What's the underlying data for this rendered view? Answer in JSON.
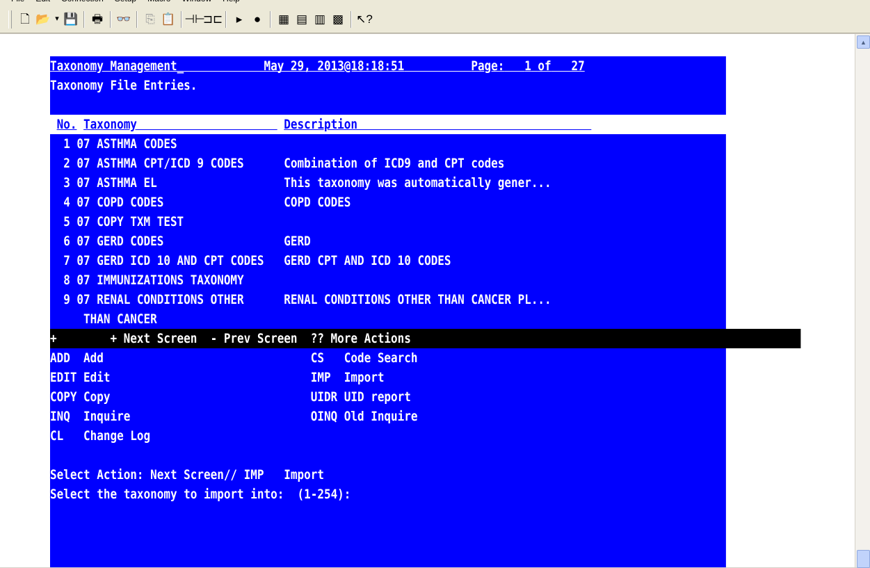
{
  "menu": {
    "items": [
      "File",
      "Edit",
      "Connection",
      "Setup",
      "Macro",
      "Window",
      "Help"
    ]
  },
  "toolbar": {
    "buttons": [
      {
        "icon": "new-document-icon",
        "glyph": "🗋"
      },
      {
        "icon": "open-folder-icon",
        "glyph": "📂"
      },
      {
        "icon": "dropdown-arrow-icon",
        "glyph": "▾"
      },
      {
        "icon": "save-icon",
        "glyph": "💾"
      },
      {
        "icon": "print-icon",
        "glyph": "🖶"
      },
      {
        "icon": "find-icon",
        "glyph": "👓"
      },
      {
        "icon": "copy-icon",
        "glyph": "⎘"
      },
      {
        "icon": "paste-icon",
        "glyph": "📋"
      },
      {
        "icon": "connect-icon",
        "glyph": "⊣⊢"
      },
      {
        "icon": "disconnect-icon",
        "glyph": "⊐⊏"
      },
      {
        "icon": "play-macro-icon",
        "glyph": "▸"
      },
      {
        "icon": "record-macro-icon",
        "glyph": "●"
      },
      {
        "icon": "window-cascade-icon",
        "glyph": "▦"
      },
      {
        "icon": "window-tile-icon",
        "glyph": "▤"
      },
      {
        "icon": "window-arrange-icon",
        "glyph": "▥"
      },
      {
        "icon": "window-all-icon",
        "glyph": "▩"
      },
      {
        "icon": "context-help-icon",
        "glyph": "↖?"
      }
    ]
  },
  "terminal": {
    "header": {
      "title": "Taxonomy Management_",
      "datetime": "May 29, 2013@18:18:51",
      "page_label": "Page:",
      "page_number": "1",
      "page_of": "of",
      "page_total": "27"
    },
    "subtitle": "Taxonomy File Entries.",
    "columns": {
      "no": "No.",
      "taxonomy": "Taxonomy",
      "description": "Description"
    },
    "entries": [
      {
        "no": "1",
        "taxonomy": "07 ASTHMA CODES",
        "description": ""
      },
      {
        "no": "2",
        "taxonomy": "07 ASTHMA CPT/ICD 9 CODES",
        "description": "Combination of ICD9 and CPT codes"
      },
      {
        "no": "3",
        "taxonomy": "07 ASTHMA EL",
        "description": "This taxonomy was automatically gener..."
      },
      {
        "no": "4",
        "taxonomy": "07 COPD CODES",
        "description": "COPD CODES"
      },
      {
        "no": "5",
        "taxonomy": "07 COPY TXM TEST",
        "description": ""
      },
      {
        "no": "6",
        "taxonomy": "07 GERD CODES",
        "description": "GERD"
      },
      {
        "no": "7",
        "taxonomy": "07 GERD ICD 10 AND CPT CODES",
        "description": "GERD CPT AND ICD 10 CODES"
      },
      {
        "no": "8",
        "taxonomy": "07 IMMUNIZATIONS TAXONOMY",
        "description": ""
      },
      {
        "no": "9",
        "taxonomy": "07 RENAL CONDITIONS OTHER",
        "description": "RENAL CONDITIONS OTHER THAN CANCER PL..."
      }
    ],
    "continuation": "THAN CANCER",
    "nav_bar": {
      "marker": "+",
      "next": "+ Next Screen",
      "prev": "- Prev Screen",
      "more": "?? More Actions"
    },
    "actions_left": [
      {
        "code": "ADD",
        "label": "Add"
      },
      {
        "code": "EDIT",
        "label": "Edit"
      },
      {
        "code": "COPY",
        "label": "Copy"
      },
      {
        "code": "INQ",
        "label": "Inquire"
      },
      {
        "code": "CL",
        "label": "Change Log"
      }
    ],
    "actions_right": [
      {
        "code": "CS",
        "label": "Code Search"
      },
      {
        "code": "IMP",
        "label": "Import"
      },
      {
        "code": "UIDR",
        "label": "UID report"
      },
      {
        "code": "OINQ",
        "label": "Old Inquire"
      }
    ],
    "prompt1": {
      "text": "Select Action: Next Screen// IMP",
      "selection": "Import"
    },
    "prompt2": "Select the taxonomy to import into:  (1-254):"
  },
  "colors": {
    "screen_background": "#0000ff",
    "screen_text": "#ffffff",
    "nav_bar_background": "#000000"
  }
}
